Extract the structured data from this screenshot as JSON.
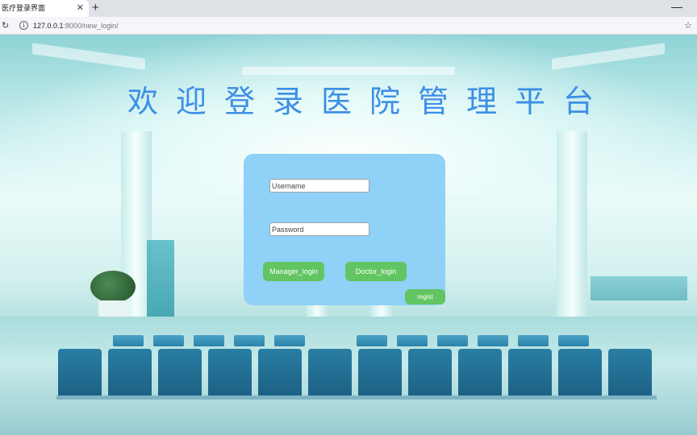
{
  "browser": {
    "tab_title": "医疗登录界面",
    "tab_close_icon": "close-icon",
    "new_tab_icon": "plus-icon",
    "minimize_icon": "minimize-icon",
    "reload_icon": "reload-icon",
    "site_info_icon": "info-icon",
    "url_host": "127.0.0.1",
    "url_rest": ":8000/new_login/",
    "bookmark_icon": "star-icon"
  },
  "page": {
    "title": "欢迎登录医院管理平台",
    "username_placeholder": "Username",
    "password_placeholder": "Password",
    "manager_login_label": "Manager_login",
    "doctor_login_label": "Doctor_login",
    "regist_label": "regist",
    "colors": {
      "title": "#3d8fe6",
      "panel": "#8fd1f7",
      "button": "#62c561"
    }
  }
}
